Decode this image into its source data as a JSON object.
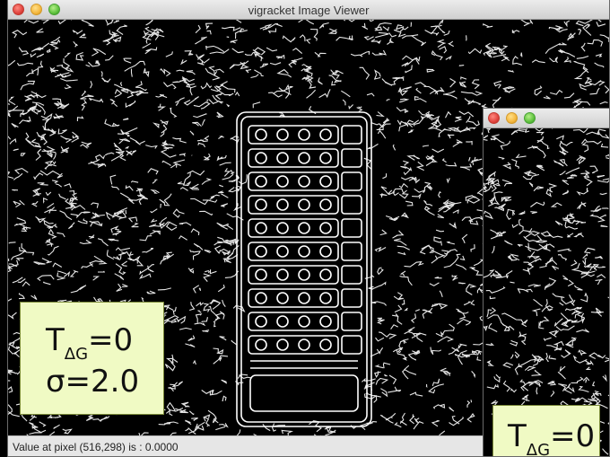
{
  "main_window": {
    "title": "vigracket Image Viewer",
    "status": "Value at pixel (516,298) is : 0.0000",
    "label": {
      "t_main": "T",
      "t_sub": "ΔG",
      "t_value": "=0",
      "sigma": "σ=2.0"
    }
  },
  "second_window": {
    "label": {
      "t_main": "T",
      "t_sub": "ΔG",
      "t_value": "=0"
    }
  }
}
